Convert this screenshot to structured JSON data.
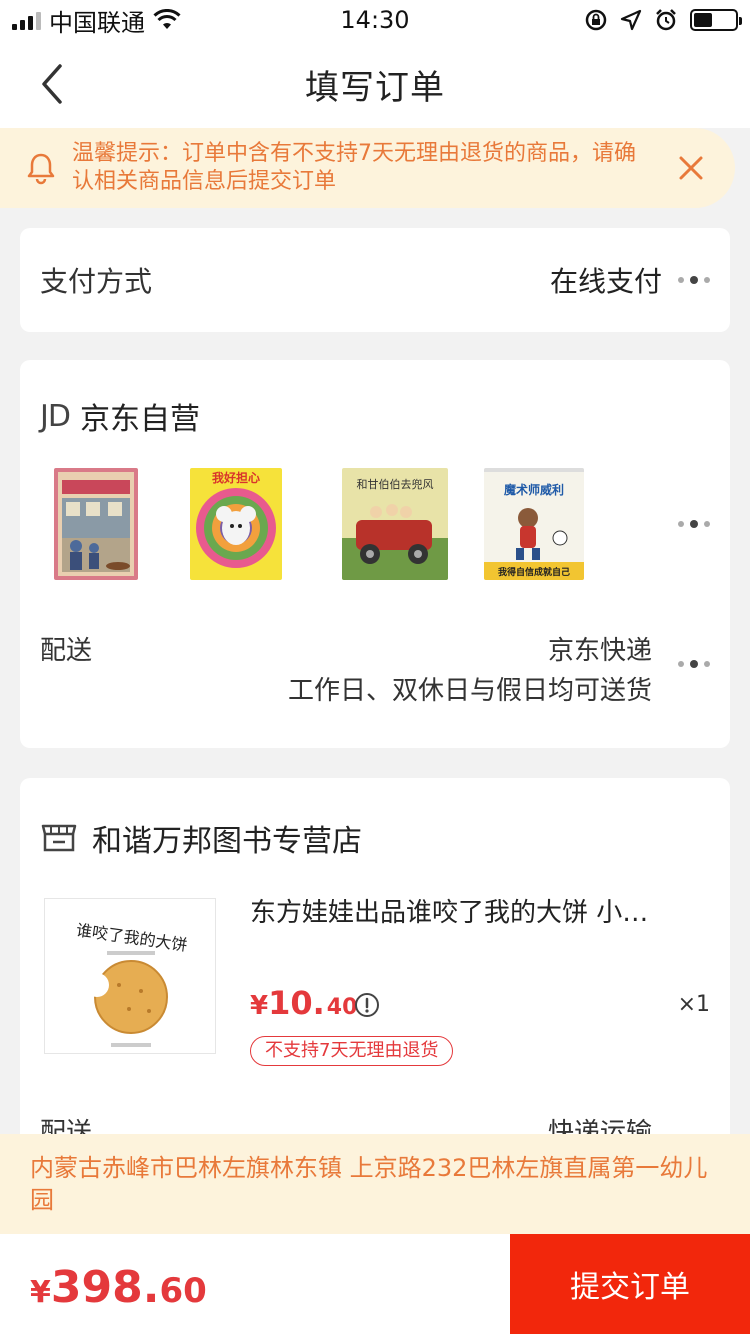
{
  "status_bar": {
    "carrier": "中国联通",
    "time": "14:30"
  },
  "nav": {
    "title": "填写订单"
  },
  "notice": {
    "text": "温馨提示：订单中含有不支持7天无理由退货的商品，请确认相关商品信息后提交订单"
  },
  "payment": {
    "label": "支付方式",
    "value": "在线支付"
  },
  "jd_section": {
    "logo": "JD",
    "shop_name": "京东自营",
    "books": [
      {
        "title": ""
      },
      {
        "title": "我好担心"
      },
      {
        "title": "和甘伯伯去兜风"
      },
      {
        "title": "魔术师威利"
      }
    ],
    "book4_subtitle": "我得自信成就自己",
    "delivery_label": "配送",
    "delivery_type": "京东快递",
    "delivery_note": "工作日、双休日与假日均可送货"
  },
  "store_section": {
    "shop_name": "和谐万邦图书专营店",
    "product": {
      "title": "东方娃娃出品谁咬了我的大饼 小…",
      "cover_text": "谁咬了我的大饼",
      "price_currency": "¥",
      "price_int": "10.",
      "price_dec": "40",
      "quantity": "×1",
      "badge": "不支持7天无理由退货"
    },
    "delivery_label": "配送",
    "delivery_value": "快递运输"
  },
  "address": {
    "text": "内蒙古赤峰市巴林左旗林东镇 上京路232巴林左旗直属第一幼儿园"
  },
  "footer": {
    "total_currency": "¥",
    "total_int": "398.",
    "total_dec": "60",
    "submit_label": "提交订单"
  },
  "colors": {
    "accent": "#e4393c",
    "submit": "#f2270c",
    "notice_bg": "#fdf3dc",
    "notice_text": "#e8793a"
  }
}
